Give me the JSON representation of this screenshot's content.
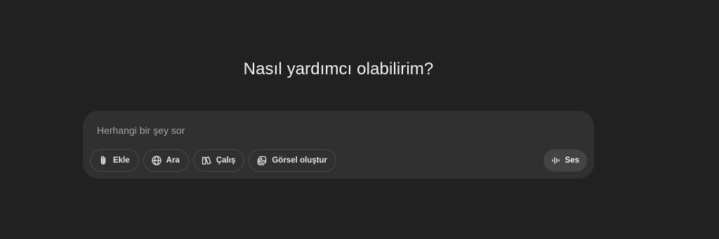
{
  "headline": "Nasıl yardımcı olabilirim?",
  "composer": {
    "placeholder": "Herhangi bir şey sor",
    "tools": [
      {
        "label": "Ekle",
        "icon": "paperclip-icon"
      },
      {
        "label": "Ara",
        "icon": "globe-icon"
      },
      {
        "label": "Çalış",
        "icon": "book-icon"
      },
      {
        "label": "Görsel oluştur",
        "icon": "image-icon"
      }
    ],
    "voice": {
      "label": "Ses",
      "icon": "audio-waveform-icon"
    }
  },
  "colors": {
    "background": "#212121",
    "composer": "#303030",
    "pill_border": "#4a4a4a",
    "voice_button": "#434343"
  }
}
